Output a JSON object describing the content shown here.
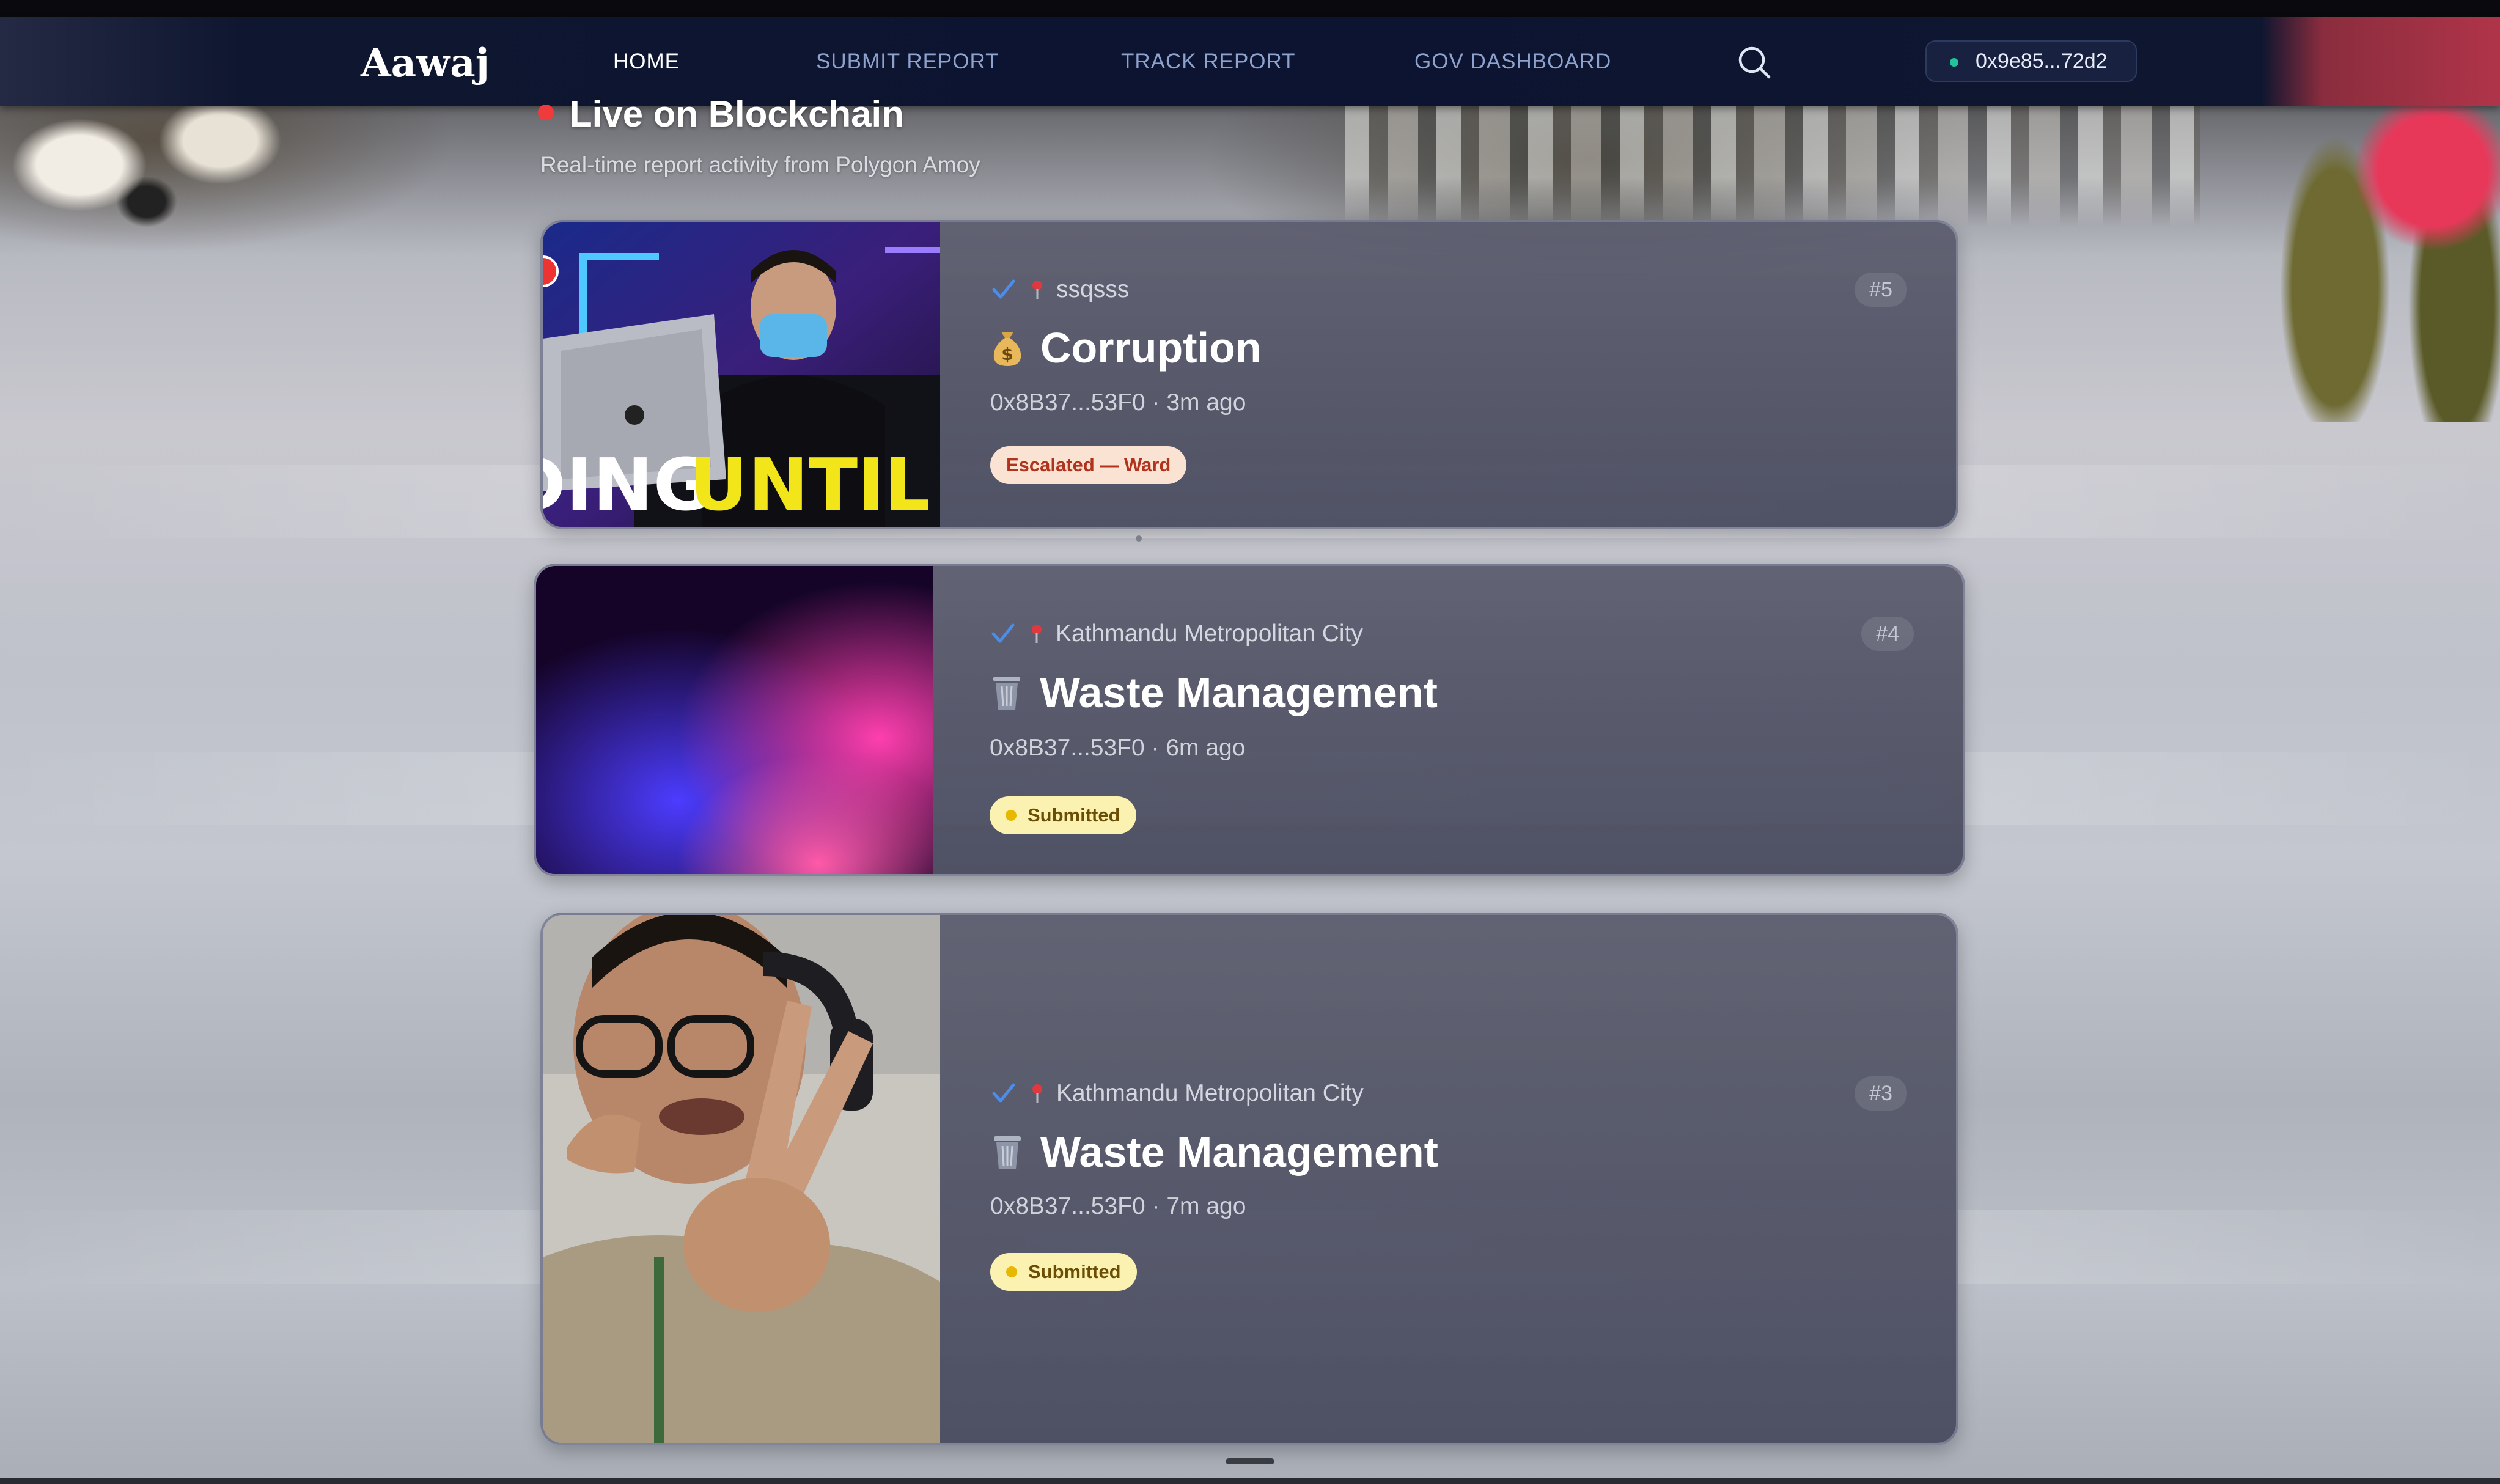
{
  "navbar": {
    "logo": "Aawaj",
    "links": [
      {
        "label": "HOME",
        "active": true
      },
      {
        "label": "SUBMIT REPORT",
        "active": false
      },
      {
        "label": "TRACK REPORT",
        "active": false
      },
      {
        "label": "GOV DASHBOARD",
        "active": false
      }
    ],
    "search_icon": "search-icon",
    "wallet": {
      "address": "0x9e85...72d2",
      "status_color": "#22c39a"
    }
  },
  "feed": {
    "title": "Live on Blockchain",
    "subtitle": "Real-time report activity from Polygon Amoy",
    "live_color": "#ef3b3b",
    "reports": [
      {
        "id": "#5",
        "location": "ssqsss",
        "category": "Corruption",
        "category_icon": "money-bag-icon",
        "reporter": "0x8B37...53F0",
        "time": "3m ago",
        "status": "Escalated — Ward",
        "status_type": "escalated",
        "thumbnail": {
          "type": "photo",
          "caption": "DING UNTIL HIRE"
        }
      },
      {
        "id": "#4",
        "location": "Kathmandu Metropolitan City",
        "category": "Waste Management",
        "category_icon": "wastebasket-icon",
        "reporter": "0x8B37...53F0",
        "time": "6m ago",
        "status": "Submitted",
        "status_type": "submitted",
        "thumbnail": {
          "type": "gradient"
        }
      },
      {
        "id": "#3",
        "location": "Kathmandu Metropolitan City",
        "category": "Waste Management",
        "category_icon": "wastebasket-icon",
        "reporter": "0x8B37...53F0",
        "time": "7m ago",
        "status": "Submitted",
        "status_type": "submitted",
        "thumbnail": {
          "type": "photo"
        }
      }
    ]
  }
}
